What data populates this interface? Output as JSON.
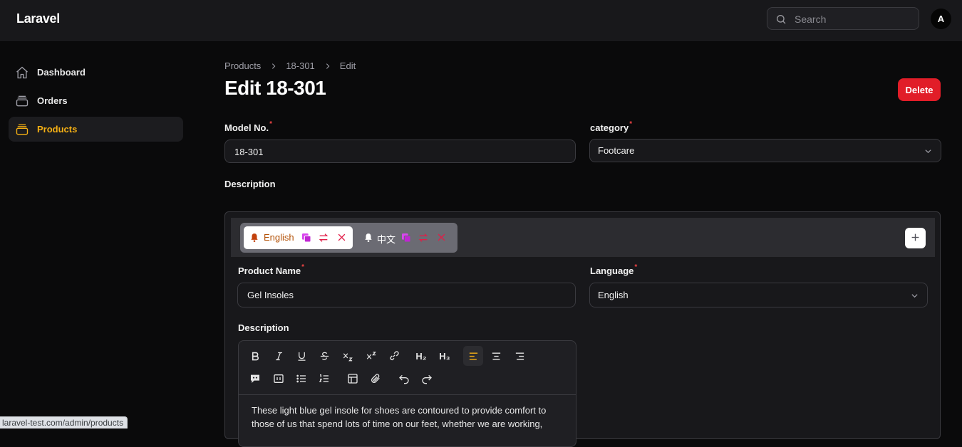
{
  "app": {
    "brand": "Laravel"
  },
  "header": {
    "search_placeholder": "Search",
    "avatar_initial": "A"
  },
  "sidebar": {
    "items": [
      {
        "label": "Dashboard",
        "icon": "home-icon",
        "active": false
      },
      {
        "label": "Orders",
        "icon": "inbox-stack-icon",
        "active": false
      },
      {
        "label": "Products",
        "icon": "archive-box-icon",
        "active": true
      }
    ]
  },
  "breadcrumb": [
    "Products",
    "18-301",
    "Edit"
  ],
  "page": {
    "title": "Edit 18-301",
    "delete_label": "Delete"
  },
  "form": {
    "model_no": {
      "label": "Model No.",
      "value": "18-301"
    },
    "category": {
      "label": "category",
      "value": "Footcare"
    },
    "description_label": "Description"
  },
  "translations": {
    "tabs": [
      {
        "label": "English",
        "active": true
      },
      {
        "label": "中文",
        "active": false
      }
    ],
    "product_name": {
      "label": "Product Name",
      "value": "Gel Insoles"
    },
    "language": {
      "label": "Language",
      "value": "English"
    },
    "description": {
      "label": "Description",
      "content": "These light blue gel insole for shoes are contoured to provide comfort to those of us that spend lots of time on our feet, whether we are working,"
    }
  },
  "status_bar": {
    "url": "laravel-test.com/admin/products"
  },
  "colors": {
    "accent": "#f5b014",
    "danger": "#e11d28",
    "background": "#0a0a0b",
    "surface": "#18181b"
  }
}
